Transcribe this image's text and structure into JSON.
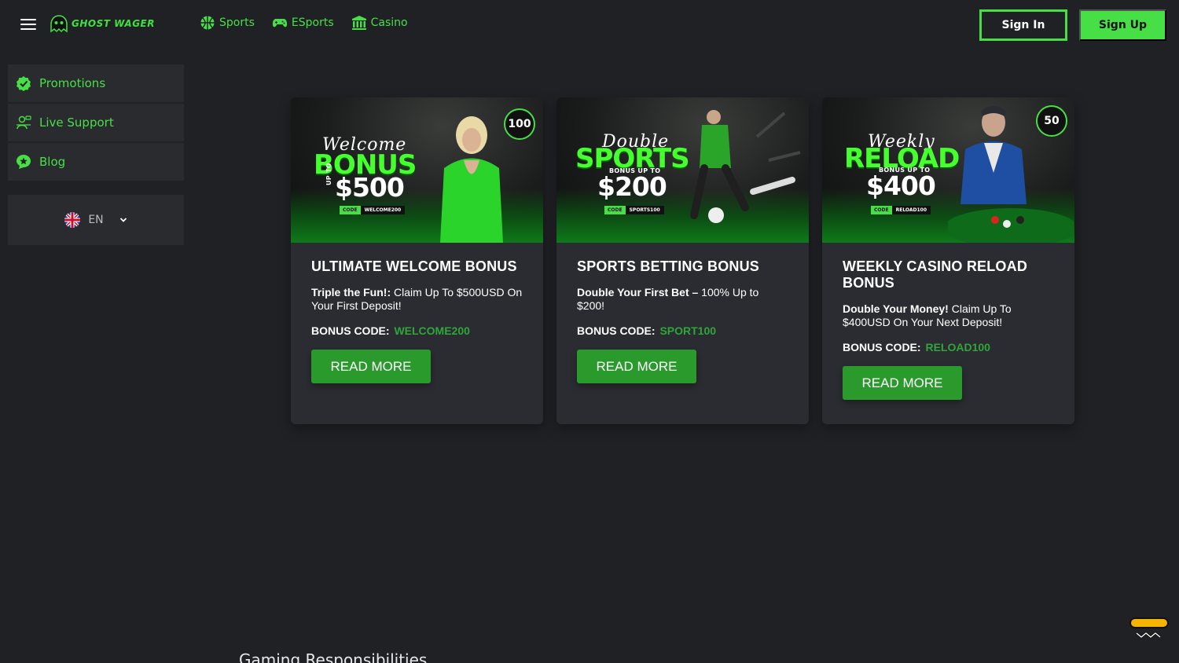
{
  "header": {
    "logo_text": "GHOST WAGER",
    "nav": [
      {
        "label": "Sports",
        "icon": "basketball-icon"
      },
      {
        "label": "ESports",
        "icon": "gamepad-icon"
      },
      {
        "label": "Casino",
        "icon": "casino-building-icon"
      }
    ],
    "signin_label": "Sign In",
    "signup_label": "Sign Up"
  },
  "sidebar": {
    "items": [
      {
        "label": "Promotions",
        "icon": "check-badge-icon"
      },
      {
        "label": "Live Support",
        "icon": "support-agent-icon"
      },
      {
        "label": "Blog",
        "icon": "star-bubble-icon"
      }
    ],
    "language": {
      "code": "EN",
      "flag": "uk-flag-icon"
    }
  },
  "promos": [
    {
      "banner": {
        "script": "Welcome",
        "big": "BONUS",
        "sub": "UP TO",
        "amount": "$500",
        "code_key": "CODE",
        "code_val": "WELCOME200",
        "badge": "100"
      },
      "title": "ULTIMATE WELCOME BONUS",
      "desc_bold": "Triple the Fun!:",
      "desc_rest": " Claim Up To $500USD On Your First Deposit!",
      "bonus_label": "BONUS CODE:",
      "bonus_code": "WELCOME200",
      "button": "READ MORE"
    },
    {
      "banner": {
        "script": "Double",
        "big": "SPORTS",
        "sub": "BONUS UP TO",
        "amount": "$200",
        "code_key": "CODE",
        "code_val": "SPORTS100",
        "badge": ""
      },
      "title": "SPORTS BETTING BONUS",
      "desc_bold": "Double Your First Bet –",
      "desc_rest": " 100% Up to $200!",
      "bonus_label": "BONUS CODE:",
      "bonus_code": "SPORT100",
      "button": "READ MORE"
    },
    {
      "banner": {
        "script": "Weekly",
        "big": "RELOAD",
        "sub": "BONUS UP TO",
        "amount": "$400",
        "code_key": "CODE",
        "code_val": "RELOAD100",
        "badge": "50"
      },
      "title": "WEEKLY CASINO RELOAD BONUS",
      "desc_bold": "Double Your Money!",
      "desc_rest": " Claim Up To $400USD On Your Next Deposit!",
      "bonus_label": "BONUS CODE:",
      "bonus_code": "RELOAD100",
      "button": "READ MORE"
    }
  ],
  "footer": {
    "heading": "Gaming Responsibilities"
  },
  "colors": {
    "accent": "#46e046",
    "bg": "#202125",
    "card": "#2a2c31",
    "button": "#2a9a2c",
    "code": "#2fa53a"
  }
}
